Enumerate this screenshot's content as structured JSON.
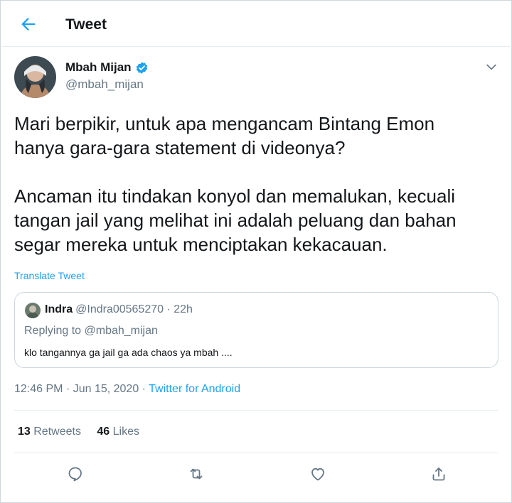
{
  "header": {
    "title": "Tweet",
    "back_icon": "back-arrow-icon"
  },
  "tweet": {
    "author": {
      "name": "Mbah Mijan",
      "handle": "@mbah_mijan",
      "verified": true
    },
    "text_lines": [
      "Mari berpikir, untuk apa mengancam Bintang Emon",
      "hanya gara-gara statement di videonya?",
      "Ancaman itu tindakan konyol dan memalukan, kecuali",
      "tangan jail yang melihat ini adalah peluang dan bahan",
      "segar mereka untuk menciptakan kekacauan."
    ],
    "translate_label": "Translate Tweet",
    "quoted": {
      "name": "Indra",
      "meta": "@Indra00565270 · 22h",
      "replying_to": "Replying to @mbah_mijan",
      "text": "klo tangannya ga jail ga ada chaos ya mbah ...."
    },
    "timestamp": "12:46 PM · Jun 15, 2020 · ",
    "source": "Twitter for Android",
    "stats": {
      "retweets_count": "13",
      "retweets_label": "Retweets",
      "likes_count": "46",
      "likes_label": "Likes"
    }
  },
  "actions": [
    "reply-icon",
    "retweet-icon",
    "like-icon",
    "share-icon"
  ],
  "colors": {
    "accent": "#1da1f2",
    "secondary_text": "#657786",
    "text": "#14171a",
    "border": "#e6ecf0"
  }
}
